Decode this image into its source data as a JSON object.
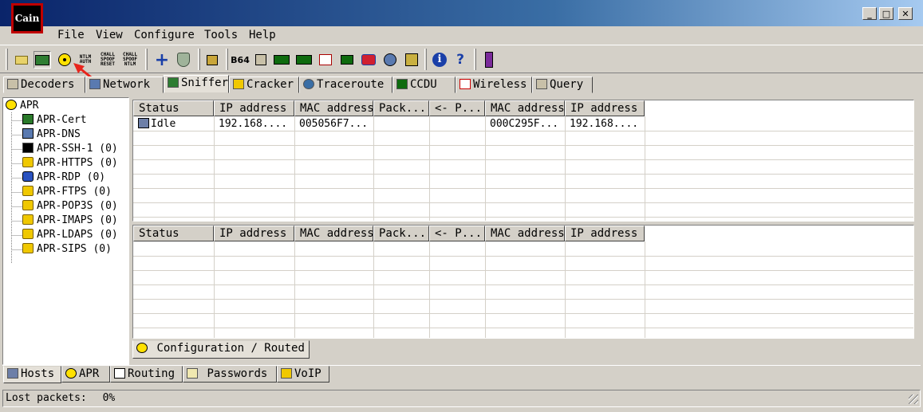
{
  "window": {
    "logo_text": "Cain",
    "minimize_label": "_",
    "maximize_label": "□",
    "close_label": "✕"
  },
  "menu": [
    "File",
    "View",
    "Configure",
    "Tools",
    "Help"
  ],
  "toolbar": {
    "ntlm_auth": "NTLM\nAUTH",
    "chall_spoof_reset": "CHALL\nSPOOF\nRESET",
    "chall_spoof_ntlm": "CHALL\nSPOOF\nNTLM",
    "b64": "B64"
  },
  "main_tabs": [
    {
      "label": "Decoders"
    },
    {
      "label": "Network"
    },
    {
      "label": "Sniffer"
    },
    {
      "label": "Cracker"
    },
    {
      "label": "Traceroute"
    },
    {
      "label": "CCDU"
    },
    {
      "label": "Wireless"
    },
    {
      "label": "Query"
    }
  ],
  "tree": {
    "root": "APR",
    "items": [
      "APR-Cert",
      "APR-DNS",
      "APR-SSH-1 (0)",
      "APR-HTTPS (0)",
      "APR-RDP (0)",
      "APR-FTPS (0)",
      "APR-POP3S (0)",
      "APR-IMAPS (0)",
      "APR-LDAPS (0)",
      "APR-SIPS (0)"
    ]
  },
  "top_grid": {
    "headers": [
      "Status",
      "IP address",
      "MAC address",
      "Pack...",
      "<- P...",
      "MAC address",
      "IP address"
    ],
    "rows": [
      [
        "Idle",
        "192.168....",
        "005056F7...",
        "",
        "",
        "000C295F...",
        "192.168...."
      ]
    ]
  },
  "bottom_grid": {
    "headers": [
      "Status",
      "IP address",
      "MAC address",
      "Pack...",
      "<- P...",
      "MAC address",
      "IP address"
    ]
  },
  "config_tab": {
    "label": "Configuration / Routed"
  },
  "bottom_tabs": [
    {
      "label": "Hosts"
    },
    {
      "label": "APR"
    },
    {
      "label": "Routing"
    },
    {
      "label": "Passwords"
    },
    {
      "label": "VoIP"
    }
  ],
  "status": {
    "label": "Lost packets:",
    "value": "0%"
  },
  "colors": {
    "arrow": "#e8241c",
    "window_bg": "#d4d0c8"
  }
}
